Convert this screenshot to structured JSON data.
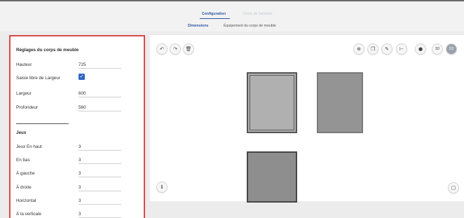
{
  "top_tabs": [
    {
      "label": "Configuration",
      "active": true
    },
    {
      "label": "Choix de l'armoire",
      "active": false
    }
  ],
  "sub_tabs": [
    {
      "label": "Dimensions",
      "active": true
    },
    {
      "label": "Équipement du corps de meuble",
      "active": false
    }
  ],
  "panel": {
    "title": "Réglages du corps de meuble",
    "fields": [
      {
        "label": "Hauteur",
        "value": "725"
      },
      {
        "label": "Saisie libre de Largeur",
        "checked": true
      },
      {
        "label": "Largeur",
        "value": "600"
      },
      {
        "label": "Profondeur",
        "value": "560"
      }
    ],
    "section_jeux": "Jeux",
    "jeux_fields": [
      {
        "label": "Jeux En haut",
        "value": "3"
      },
      {
        "label": "En bas",
        "value": "3"
      },
      {
        "label": "À gauche",
        "value": "3"
      },
      {
        "label": "À droite",
        "value": "3"
      },
      {
        "label": "Horizontal",
        "value": "3"
      },
      {
        "label": "À la verticale",
        "value": "3"
      }
    ]
  },
  "toolbar_left": [
    {
      "name": "undo-icon",
      "glyph": "↶"
    },
    {
      "name": "redo-icon",
      "glyph": "↷"
    },
    {
      "name": "trash-icon",
      "glyph": "🗑"
    }
  ],
  "toolbar_right": [
    {
      "name": "zoom-icon",
      "glyph": "⊕"
    },
    {
      "name": "copy-icon",
      "glyph": "❐"
    },
    {
      "name": "pencil-icon",
      "glyph": "✎"
    },
    {
      "name": "measure-icon",
      "glyph": "⊢"
    },
    {
      "name": "camera-icon",
      "glyph": "●"
    },
    {
      "name": "view-3d-button",
      "label": "3D"
    },
    {
      "name": "view-2d-button",
      "label": "2D",
      "active": true
    }
  ],
  "info_glyph": "i",
  "corner_glyph": "▢"
}
